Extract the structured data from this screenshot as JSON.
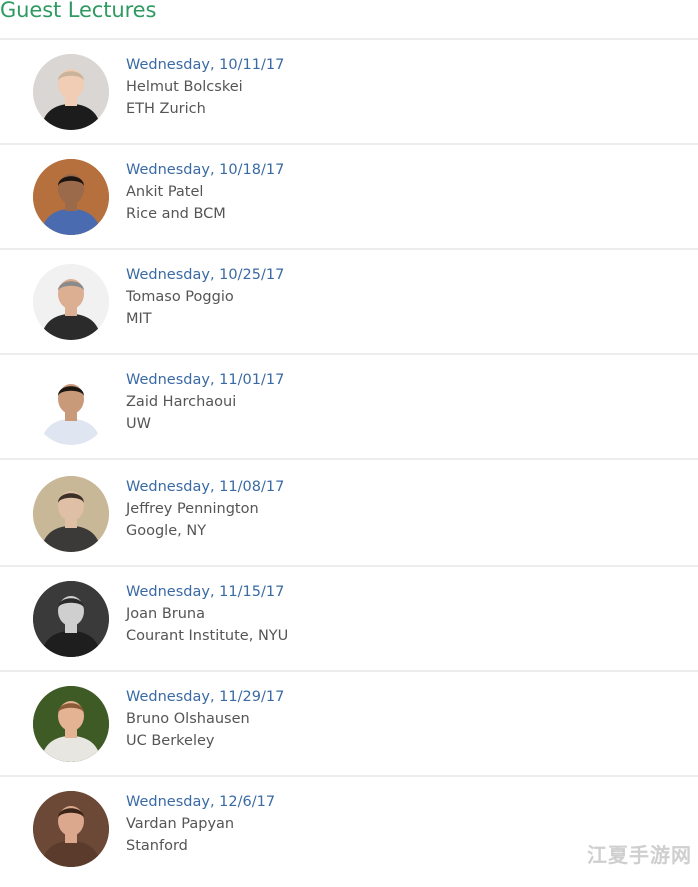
{
  "section": {
    "title": "Guest Lectures"
  },
  "lectures": [
    {
      "date": "Wednesday, 10/11/17",
      "name": "Helmut Bolcskei",
      "affiliation": "ETH Zurich",
      "photo_bg": "#d9d6d3",
      "skin": "#f0cdb4",
      "hair": "#c9b49a",
      "shirt": "#1c1c1c"
    },
    {
      "date": "Wednesday, 10/18/17",
      "name": "Ankit Patel",
      "affiliation": "Rice and BCM",
      "photo_bg": "#b5703e",
      "skin": "#9a6a4a",
      "hair": "#1b1410",
      "shirt": "#4a6bb0"
    },
    {
      "date": "Wednesday, 10/25/17",
      "name": "Tomaso Poggio",
      "affiliation": "MIT",
      "photo_bg": "#f1f1f1",
      "skin": "#dcae92",
      "hair": "#8a8a8a",
      "shirt": "#2b2b2b"
    },
    {
      "date": "Wednesday, 11/01/17",
      "name": "Zaid Harchaoui",
      "affiliation": "UW",
      "photo_bg": "#ffffff",
      "skin": "#c99a7a",
      "hair": "#1d1712",
      "shirt": "#dfe6f2"
    },
    {
      "date": "Wednesday, 11/08/17",
      "name": "Jeffrey Pennington",
      "affiliation": "Google, NY",
      "photo_bg": "#c8b898",
      "skin": "#dfbfa5",
      "hair": "#3b2f27",
      "shirt": "#3b3a38"
    },
    {
      "date": "Wednesday, 11/15/17",
      "name": "Joan Bruna",
      "affiliation": "Courant Institute, NYU",
      "photo_bg": "#3a3a3a",
      "skin": "#cfcfcf",
      "hair": "#2a2a2a",
      "shirt": "#1e1e1e"
    },
    {
      "date": "Wednesday, 11/29/17",
      "name": "Bruno Olshausen",
      "affiliation": "UC Berkeley",
      "photo_bg": "#3e5a25",
      "skin": "#e3b394",
      "hair": "#8b5a36",
      "shirt": "#e8e6e0"
    },
    {
      "date": "Wednesday, 12/6/17",
      "name": "Vardan Papyan",
      "affiliation": "Stanford",
      "photo_bg": "#6c4836",
      "skin": "#dba88e",
      "hair": "#3a2418",
      "shirt": "#5b3c2c"
    }
  ],
  "watermark": "江夏手游网",
  "colors": {
    "title": "#2e9a62",
    "date_link": "#3a6aa3",
    "text": "#555555",
    "divider": "#ededed"
  }
}
